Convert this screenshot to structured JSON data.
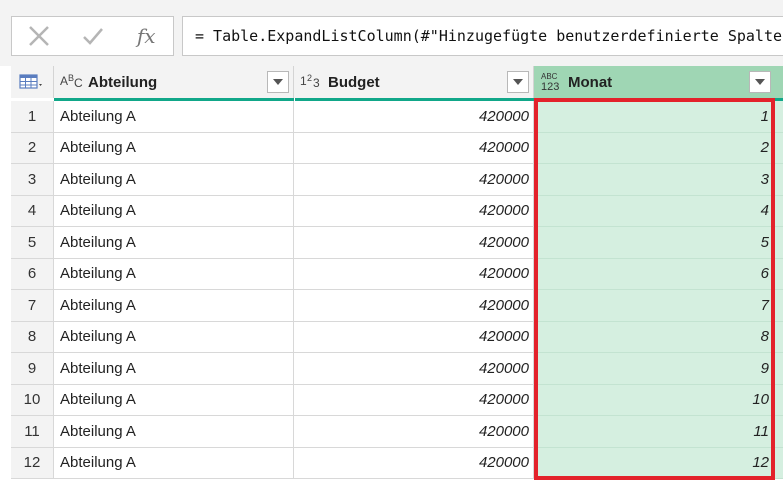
{
  "formula_bar": {
    "cancel_icon": "x-icon",
    "commit_icon": "check-icon",
    "fx_label": "fx",
    "formula_text": "= Table.ExpandListColumn(#\"Hinzugefügte benutzerdefinierte Spalte\", \"Monat\")"
  },
  "grid": {
    "columns": [
      {
        "type_label": "ABC",
        "title": "Abteilung"
      },
      {
        "type_label": "123",
        "title": "Budget"
      },
      {
        "type_label": "ABC/123",
        "title": "Monat"
      }
    ],
    "rows": [
      {
        "num": "1",
        "abteilung": "Abteilung A",
        "budget": "420000",
        "monat": "1"
      },
      {
        "num": "2",
        "abteilung": "Abteilung A",
        "budget": "420000",
        "monat": "2"
      },
      {
        "num": "3",
        "abteilung": "Abteilung A",
        "budget": "420000",
        "monat": "3"
      },
      {
        "num": "4",
        "abteilung": "Abteilung A",
        "budget": "420000",
        "monat": "4"
      },
      {
        "num": "5",
        "abteilung": "Abteilung A",
        "budget": "420000",
        "monat": "5"
      },
      {
        "num": "6",
        "abteilung": "Abteilung A",
        "budget": "420000",
        "monat": "6"
      },
      {
        "num": "7",
        "abteilung": "Abteilung A",
        "budget": "420000",
        "monat": "7"
      },
      {
        "num": "8",
        "abteilung": "Abteilung A",
        "budget": "420000",
        "monat": "8"
      },
      {
        "num": "9",
        "abteilung": "Abteilung A",
        "budget": "420000",
        "monat": "9"
      },
      {
        "num": "10",
        "abteilung": "Abteilung A",
        "budget": "420000",
        "monat": "10"
      },
      {
        "num": "11",
        "abteilung": "Abteilung A",
        "budget": "420000",
        "monat": "11"
      },
      {
        "num": "12",
        "abteilung": "Abteilung A",
        "budget": "420000",
        "monat": "12"
      }
    ]
  },
  "colors": {
    "header_bar": "#11a789",
    "selected_column_bg": "#d5efe0",
    "selected_header_bg": "#9fd6b4",
    "highlight_border": "#e3222b"
  }
}
